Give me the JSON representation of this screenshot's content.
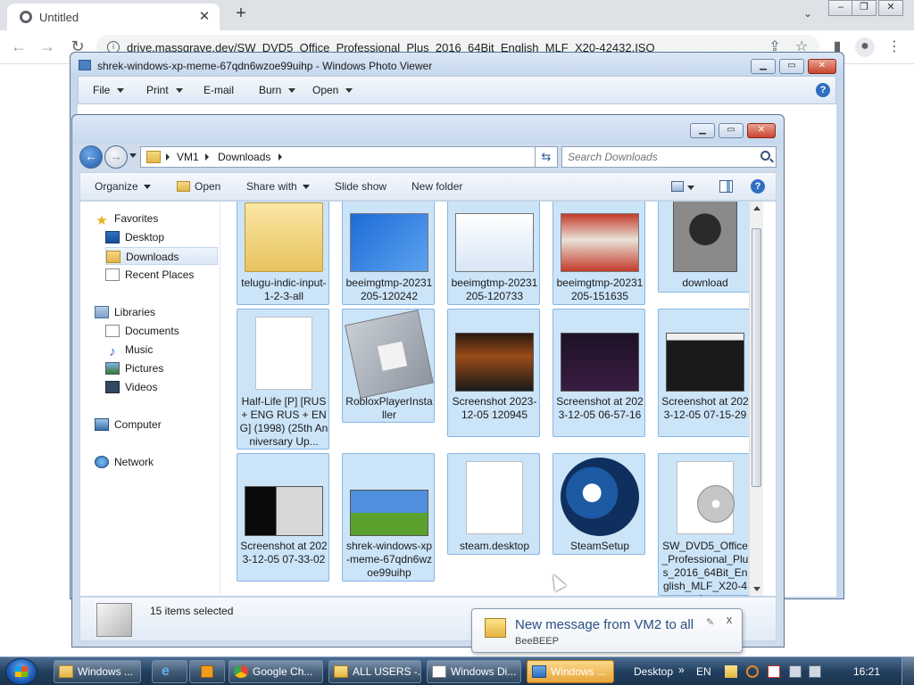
{
  "browser": {
    "tab_title": "Untitled",
    "tab_close": "✕",
    "new_tab": "+",
    "url": "drive.massgrave.dev/SW_DVD5_Office_Professional_Plus_2016_64Bit_English_MLF_X20-42432.ISO",
    "back_glyph": "←",
    "forward_glyph": "→",
    "reload_glyph": "↻",
    "share_glyph": "⇪",
    "star_glyph": "☆",
    "menu_glyph": "⋮",
    "tab_search_glyph": "⌄"
  },
  "photo_viewer": {
    "title": "shrek-windows-xp-meme-67qdn6wzoe99uihp - Windows Photo Viewer",
    "menus": [
      "File",
      "Print",
      "E-mail",
      "Burn",
      "Open"
    ],
    "help_glyph": "?"
  },
  "explorer": {
    "breadcrumb": [
      "VM1",
      "Downloads"
    ],
    "search_placeholder": "Search Downloads",
    "commands": {
      "organize": "Organize",
      "open": "Open",
      "share_with": "Share with",
      "slide_show": "Slide show",
      "new_folder": "New folder"
    },
    "nav": {
      "favorites": "Favorites",
      "desktop": "Desktop",
      "downloads": "Downloads",
      "recent_places": "Recent Places",
      "libraries": "Libraries",
      "documents": "Documents",
      "music": "Music",
      "pictures": "Pictures",
      "videos": "Videos",
      "computer": "Computer",
      "network": "Network"
    },
    "files": [
      {
        "name": "telugu-indic-input-1-2-3-all",
        "kind": "folder"
      },
      {
        "name": "beeimgtmp-20231205-120242",
        "kind": "screenshot"
      },
      {
        "name": "beeimgtmp-20231205-120733",
        "kind": "screenshot"
      },
      {
        "name": "beeimgtmp-20231205-151635",
        "kind": "screenshot"
      },
      {
        "name": "download",
        "kind": "photo"
      },
      {
        "name": "Half-Life [P] [RUS + ENG RUS + ENG] (1998) (25th Anniversary Up...",
        "kind": "document"
      },
      {
        "name": "RobloxPlayerInstaller",
        "kind": "app"
      },
      {
        "name": "Screenshot 2023-12-05 120945",
        "kind": "screenshot"
      },
      {
        "name": "Screenshot at 2023-12-05 06-57-16",
        "kind": "screenshot"
      },
      {
        "name": "Screenshot at 2023-12-05 07-15-29",
        "kind": "screenshot"
      },
      {
        "name": "Screenshot at 2023-12-05 07-33-02",
        "kind": "screenshot"
      },
      {
        "name": "shrek-windows-xp-meme-67qdn6wzoe99uihp",
        "kind": "screenshot"
      },
      {
        "name": "steam.desktop",
        "kind": "document"
      },
      {
        "name": "SteamSetup",
        "kind": "app"
      },
      {
        "name": "SW_DVD5_Office_Professional_Plus_2016_64Bit_English_MLF_X20-42...",
        "kind": "disc"
      }
    ],
    "status": "15 items selected"
  },
  "notification": {
    "title": "New message from VM2 to all",
    "subtitle": "BeeBEEP",
    "close_glyph": "x"
  },
  "taskbar": {
    "buttons": [
      "Windows ...",
      "Google Ch...",
      "ALL USERS -...",
      "Windows Di...",
      "Windows ..."
    ],
    "desktop_label": "Desktop",
    "overflow": "»",
    "language": "EN",
    "clock": "16:21"
  },
  "colors": {
    "selection_fill": "#cce4f8",
    "selection_border": "#84b7e6",
    "taskbar": "#23405f",
    "active_task": "#e8a53a"
  }
}
